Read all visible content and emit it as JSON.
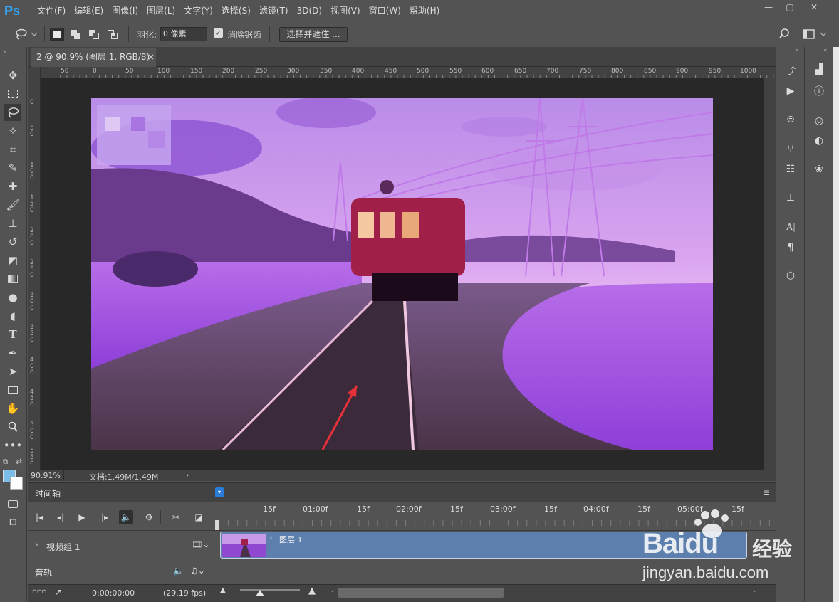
{
  "app": {
    "logo": "Ps"
  },
  "menu": [
    "文件(F)",
    "编辑(E)",
    "图像(I)",
    "图层(L)",
    "文字(Y)",
    "选择(S)",
    "滤镜(T)",
    "3D(D)",
    "视图(V)",
    "窗口(W)",
    "帮助(H)"
  ],
  "window_controls": [
    "—",
    "▢",
    "✕"
  ],
  "options": {
    "feather_label": "羽化:",
    "feather_value": "0 像素",
    "antialias_label": "消除锯齿",
    "antialias_checked": true,
    "select_mask_label": "选择并遮住 ..."
  },
  "document": {
    "tab_label": "2 @ 90.9% (图层 1, RGB/8)",
    "tab_close": "×",
    "zoom": "90.91%",
    "doc_info": "文档:1.49M/1.49M"
  },
  "rulers": {
    "h_ticks": [
      "50",
      "0",
      "50",
      "100",
      "150",
      "200",
      "250",
      "300",
      "350",
      "400",
      "450",
      "500",
      "550",
      "600",
      "650",
      "700",
      "750",
      "800",
      "850",
      "900",
      "950",
      "1000"
    ],
    "v_ticks": [
      "0",
      "5\n0",
      "1\n0\n0",
      "1\n5\n0",
      "2\n0\n0",
      "2\n5\n0",
      "3\n0\n0",
      "3\n5\n0",
      "4\n0\n0",
      "4\n5\n0",
      "5\n0\n0",
      "5\n5\n0"
    ]
  },
  "timeline": {
    "title": "时间轴",
    "time_labels": [
      "15f",
      "01:00f",
      "15f",
      "02:00f",
      "15f",
      "03:00f",
      "15f",
      "04:00f",
      "15f",
      "05:00f",
      "15f"
    ],
    "video_group_label": "视频组 1",
    "audio_label": "音轨",
    "clip_label": "图层 1",
    "current_time": "0:00:00:00",
    "fps": "(29.19 fps)"
  },
  "watermark": {
    "brand": "Baidu",
    "sub_label": "经验",
    "url": "jingyan.baidu.com"
  },
  "colors": {
    "accent": "#31a8ff",
    "foreground": "#7bbde9",
    "background": "#ffffff",
    "clip": "#5d7fae",
    "playhead": "#e23b3b"
  }
}
